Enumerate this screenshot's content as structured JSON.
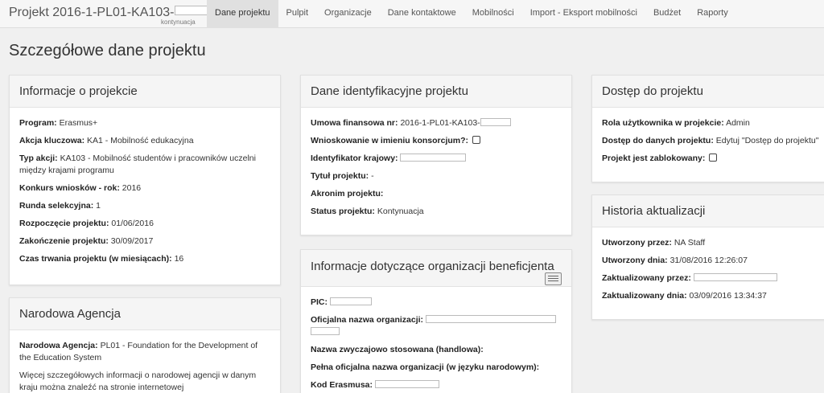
{
  "header": {
    "project_prefix": "Projekt 2016-1-PL01-KA103-",
    "project_status": "kontynuacja"
  },
  "nav": [
    {
      "label": "Dane projektu"
    },
    {
      "label": "Pulpit"
    },
    {
      "label": "Organizacje"
    },
    {
      "label": "Dane kontaktowe"
    },
    {
      "label": "Mobilności"
    },
    {
      "label": "Import - Eksport mobilności"
    },
    {
      "label": "Budżet"
    },
    {
      "label": "Raporty"
    }
  ],
  "page": {
    "title": "Szczegółowe dane projektu"
  },
  "info": {
    "title": "Informacje o projekcie",
    "rows": [
      {
        "label": "Program:",
        "value": "Erasmus+"
      },
      {
        "label": "Akcja kluczowa:",
        "value": "KA1 - Mobilność edukacyjna"
      },
      {
        "label": "Typ akcji:",
        "value": "KA103 - Mobilność studentów i pracowników uczelni między krajami programu"
      },
      {
        "label": "Konkurs wniosków - rok:",
        "value": "2016"
      },
      {
        "label": "Runda selekcyjna:",
        "value": "1"
      },
      {
        "label": "Rozpoczęcie projektu:",
        "value": "01/06/2016"
      },
      {
        "label": "Zakończenie projektu:",
        "value": "30/09/2017"
      },
      {
        "label": "Czas trwania projektu (w miesiącach):",
        "value": "16"
      }
    ]
  },
  "na": {
    "title": "Narodowa Agencja",
    "label": "Narodowa Agencja:",
    "value": "PL01 - Foundation for the Development of the Education System",
    "note": "Więcej szczegółowych informacji o narodowej agencji w danym kraju można znaleźć na stronie internetowej"
  },
  "ident": {
    "title": "Dane identyfikacyjne projektu",
    "contract_label": "Umowa finansowa nr:",
    "contract_value": "2016-1-PL01-KA103-",
    "consortium_label": "Wnioskowanie w imieniu konsorcjum?:",
    "national_id_label": "Identyfikator krajowy:",
    "title_label": "Tytuł projektu:",
    "title_value": "-",
    "acronym_label": "Akronim projektu:",
    "status_label": "Status projektu:",
    "status_value": "Kontynuacja"
  },
  "beneficiary": {
    "title": "Informacje dotyczące organizacji beneficjenta",
    "icon": "list-icon",
    "pic_label": "PIC:",
    "legal_name_label": "Oficjalna nazwa organizacji:",
    "business_name_label": "Nazwa zwyczajowo stosowana (handlowa):",
    "national_name_label": "Pełna oficjalna nazwa organizacji (w języku narodowym):",
    "erasmus_code_label": "Kod Erasmusa:"
  },
  "access": {
    "title": "Dostęp do projektu",
    "role_label": "Rola użytkownika w projekcie:",
    "role_value": "Admin",
    "data_access_label": "Dostęp do danych projektu:",
    "data_access_value": "Edytuj \"Dostęp do projektu\"",
    "locked_label": "Projekt jest zablokowany:"
  },
  "history": {
    "title": "Historia aktualizacji",
    "created_by_label": "Utworzony przez:",
    "created_by_value": "NA Staff",
    "created_on_label": "Utworzony dnia:",
    "created_on_value": "31/08/2016 12:26:07",
    "updated_by_label": "Zaktualizowany przez:",
    "updated_on_label": "Zaktualizowany dnia:",
    "updated_on_value": "03/09/2016 13:34:37"
  }
}
